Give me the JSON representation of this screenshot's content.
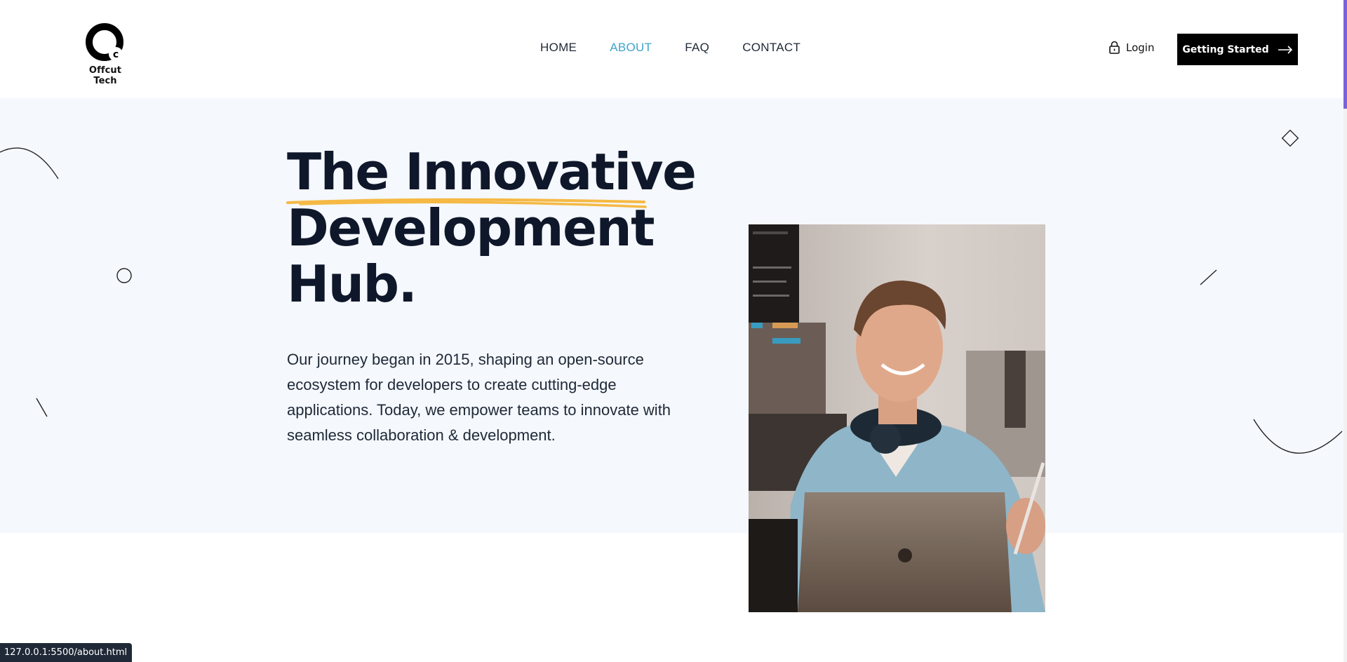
{
  "brand": {
    "name": "Offcut Tech",
    "logo_letter": "c",
    "icon": "offcut-logo-mark"
  },
  "nav": {
    "items": [
      {
        "label": "HOME",
        "active": false
      },
      {
        "label": "ABOUT",
        "active": true
      },
      {
        "label": "FAQ",
        "active": false
      },
      {
        "label": "CONTACT",
        "active": false
      }
    ],
    "active_color": "#3fa4c8"
  },
  "header_actions": {
    "login_label": "Login",
    "login_icon": "lock-icon",
    "cta_label": "Getting Started",
    "cta_icon": "arrow-right-icon"
  },
  "hero": {
    "headline_lines": [
      "The Innovative",
      "Development",
      "Hub."
    ],
    "underline_color": "#f5b944",
    "intro_lines": [
      "Our journey began in 2015, shaping an open-source",
      "ecosystem for developers to create cutting-edge",
      "applications. Today, we empower teams to innovate with",
      "seamless collaboration & development."
    ],
    "image_subject": "smiling-man-with-headphones-at-laptop"
  },
  "status_bar": {
    "url": "127.0.0.1:5500/about.html"
  },
  "colors": {
    "hero_background": "#f5f8fd",
    "text_dark": "#0f172a",
    "cta_background": "#000000",
    "scroll_accent": "#7a62d8"
  }
}
